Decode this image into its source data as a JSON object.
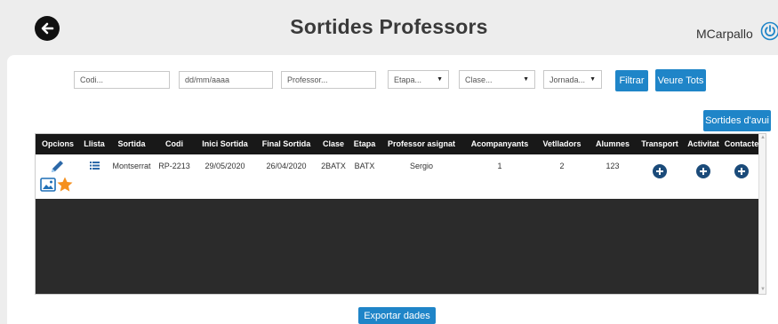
{
  "header": {
    "title": "Sortides Professors",
    "user": "MCarpallo"
  },
  "filters": {
    "codi_placeholder": "Codi...",
    "date_placeholder": "dd/mm/aaaa",
    "professor_placeholder": "Professor...",
    "etapa": "Etapa...",
    "clase": "Clase...",
    "jornada": "Jornada...",
    "filter_label": "Filtrar",
    "show_all_label": "Veure Tots"
  },
  "today_button": "Sortides d'avui",
  "table": {
    "columns": [
      "Opcions",
      "Llista",
      "Sortida",
      "Codi",
      "Inici Sortida",
      "Final Sortida",
      "Clase",
      "Etapa",
      "Professor asignat",
      "Acompanyants",
      "Vetlladors",
      "Alumnes",
      "Transport",
      "Activitat",
      "Contacte"
    ],
    "rows": [
      {
        "sortida": "Montserrat",
        "codi": "RP-2213",
        "inici": "29/05/2020",
        "final": "26/04/2020",
        "clase": "2BATX",
        "etapa": "BATX",
        "professor": "Sergio",
        "acompanyants": "1",
        "vetlladors": "2",
        "alumnes": "123"
      }
    ]
  },
  "export_label": "Exportar dades",
  "colors": {
    "accent": "#1f85c8",
    "table_header": "#181818",
    "table_body": "#2b2b2b",
    "plus_icon": "#1b4b7a",
    "star": "#f5901e"
  },
  "icons": [
    "back-arrow-icon",
    "power-icon",
    "pencil-icon",
    "list-icon",
    "image-icon",
    "star-icon",
    "plus-circle-icon"
  ]
}
